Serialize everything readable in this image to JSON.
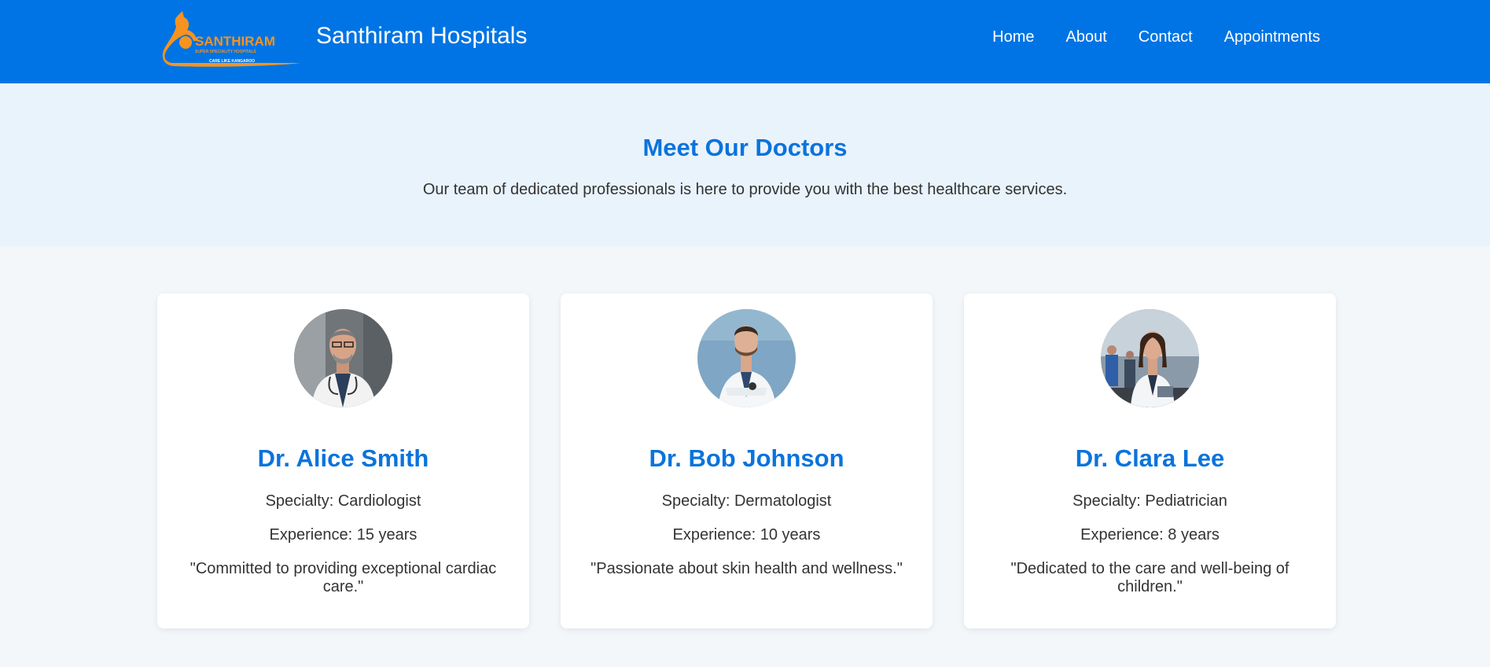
{
  "header": {
    "site_title": "Santhiram Hospitals",
    "logo_text": "SANTHIRAM",
    "logo_subtext": "SUPER SPECIALITY HOSPITALS",
    "logo_tagline": "CARE LIKE KANGAROO",
    "nav": [
      "Home",
      "About",
      "Contact",
      "Appointments"
    ]
  },
  "hero": {
    "title": "Meet Our Doctors",
    "subtitle": "Our team of dedicated professionals is here to provide you with the best healthcare services."
  },
  "doctors": [
    {
      "name": "Dr. Alice Smith",
      "specialty": "Specialty: Cardiologist",
      "experience": "Experience: 15 years",
      "quote": "\"Committed to providing exceptional cardiac care.\""
    },
    {
      "name": "Dr. Bob Johnson",
      "specialty": "Specialty: Dermatologist",
      "experience": "Experience: 10 years",
      "quote": "\"Passionate about skin health and wellness.\""
    },
    {
      "name": "Dr. Clara Lee",
      "specialty": "Specialty: Pediatrician",
      "experience": "Experience: 8 years",
      "quote": "\"Dedicated to the care and well-being of children.\""
    }
  ],
  "colors": {
    "header_bg": "#0074e4",
    "accent": "#0a73dc",
    "hero_bg": "#e9f3fc",
    "logo_orange": "#f7931e"
  }
}
